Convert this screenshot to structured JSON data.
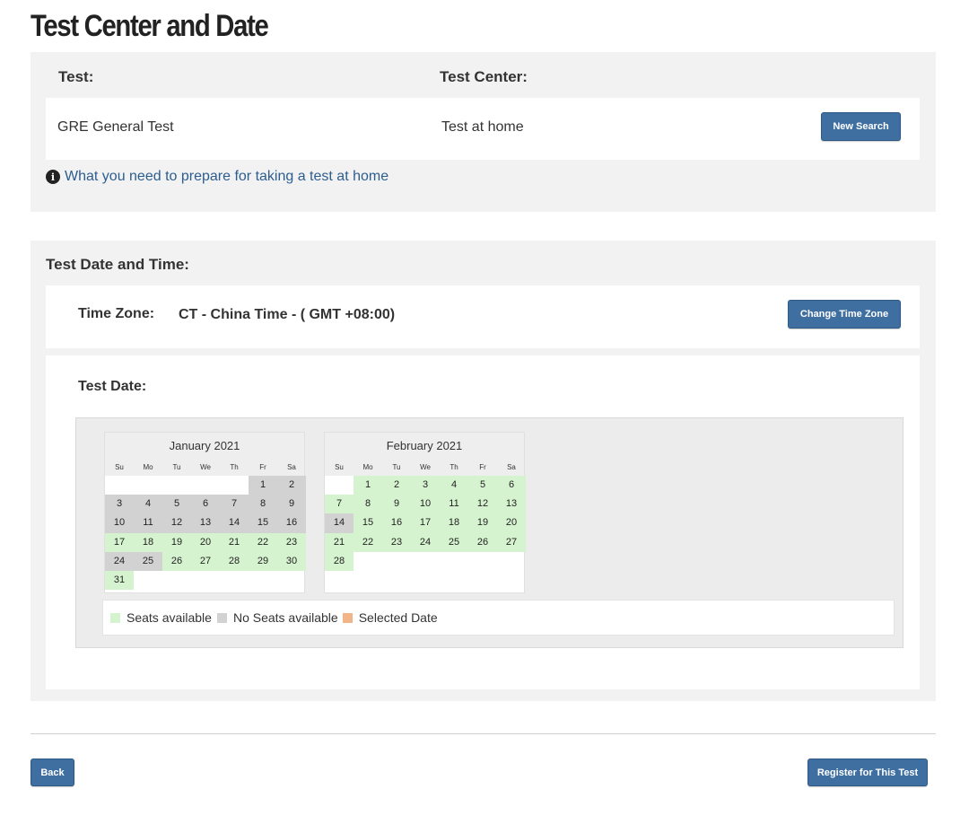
{
  "page": {
    "title": "Test Center and Date"
  },
  "test_info": {
    "test_label": "Test:",
    "center_label": "Test Center:",
    "test_value": "GRE General Test",
    "center_value": "Test at home",
    "new_search_label": "New Search",
    "info_link": "What you need to prepare for taking a test at home",
    "info_icon": "info-circle-icon"
  },
  "date_time": {
    "section_label": "Test Date and Time:",
    "timezone_label": "Time Zone:",
    "timezone_value": "CT - China Time - ( GMT +08:00)",
    "change_tz_label": "Change Time Zone",
    "test_date_label": "Test Date:"
  },
  "calendars": [
    {
      "month": "January 2021",
      "weekdays": [
        "Su",
        "Mo",
        "Tu",
        "We",
        "Th",
        "Fr",
        "Sa"
      ],
      "lead_blanks": 5,
      "days": [
        {
          "d": "1",
          "s": "none"
        },
        {
          "d": "2",
          "s": "none"
        },
        {
          "d": "3",
          "s": "none"
        },
        {
          "d": "4",
          "s": "none"
        },
        {
          "d": "5",
          "s": "none"
        },
        {
          "d": "6",
          "s": "none"
        },
        {
          "d": "7",
          "s": "none"
        },
        {
          "d": "8",
          "s": "none"
        },
        {
          "d": "9",
          "s": "none"
        },
        {
          "d": "10",
          "s": "none"
        },
        {
          "d": "11",
          "s": "none"
        },
        {
          "d": "12",
          "s": "none"
        },
        {
          "d": "13",
          "s": "none"
        },
        {
          "d": "14",
          "s": "none"
        },
        {
          "d": "15",
          "s": "none"
        },
        {
          "d": "16",
          "s": "none"
        },
        {
          "d": "17",
          "s": "avail"
        },
        {
          "d": "18",
          "s": "avail"
        },
        {
          "d": "19",
          "s": "avail"
        },
        {
          "d": "20",
          "s": "avail"
        },
        {
          "d": "21",
          "s": "avail"
        },
        {
          "d": "22",
          "s": "avail"
        },
        {
          "d": "23",
          "s": "avail"
        },
        {
          "d": "24",
          "s": "none"
        },
        {
          "d": "25",
          "s": "none"
        },
        {
          "d": "26",
          "s": "avail"
        },
        {
          "d": "27",
          "s": "avail"
        },
        {
          "d": "28",
          "s": "avail"
        },
        {
          "d": "29",
          "s": "avail"
        },
        {
          "d": "30",
          "s": "avail"
        },
        {
          "d": "31",
          "s": "avail"
        }
      ]
    },
    {
      "month": "February 2021",
      "weekdays": [
        "Su",
        "Mo",
        "Tu",
        "We",
        "Th",
        "Fr",
        "Sa"
      ],
      "lead_blanks": 1,
      "days": [
        {
          "d": "1",
          "s": "avail"
        },
        {
          "d": "2",
          "s": "avail"
        },
        {
          "d": "3",
          "s": "avail"
        },
        {
          "d": "4",
          "s": "avail"
        },
        {
          "d": "5",
          "s": "avail"
        },
        {
          "d": "6",
          "s": "avail"
        },
        {
          "d": "7",
          "s": "avail"
        },
        {
          "d": "8",
          "s": "avail"
        },
        {
          "d": "9",
          "s": "avail"
        },
        {
          "d": "10",
          "s": "avail"
        },
        {
          "d": "11",
          "s": "avail"
        },
        {
          "d": "12",
          "s": "avail"
        },
        {
          "d": "13",
          "s": "avail"
        },
        {
          "d": "14",
          "s": "none"
        },
        {
          "d": "15",
          "s": "avail"
        },
        {
          "d": "16",
          "s": "avail"
        },
        {
          "d": "17",
          "s": "avail"
        },
        {
          "d": "18",
          "s": "avail"
        },
        {
          "d": "19",
          "s": "avail"
        },
        {
          "d": "20",
          "s": "avail"
        },
        {
          "d": "21",
          "s": "avail"
        },
        {
          "d": "22",
          "s": "avail"
        },
        {
          "d": "23",
          "s": "avail"
        },
        {
          "d": "24",
          "s": "avail"
        },
        {
          "d": "25",
          "s": "avail"
        },
        {
          "d": "26",
          "s": "avail"
        },
        {
          "d": "27",
          "s": "avail"
        },
        {
          "d": "28",
          "s": "avail"
        }
      ]
    }
  ],
  "legend": {
    "available": "Seats available",
    "no_seats": "No Seats available",
    "selected": "Selected Date",
    "colors": {
      "available": "#d6f3cf",
      "no_seats": "#d2d2d2",
      "selected": "#f2b58a"
    }
  },
  "footer": {
    "back_label": "Back",
    "register_label": "Register for This Test"
  },
  "colors": {
    "button": "#3f6fa0",
    "link": "#2c5d8f"
  }
}
